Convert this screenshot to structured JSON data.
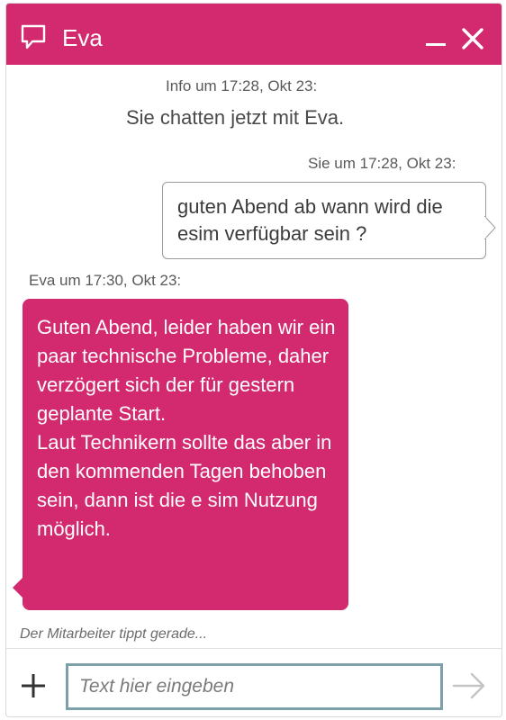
{
  "header": {
    "title": "Eva",
    "icons": {
      "chat": "chat-bubble-icon",
      "minimize": "minimize-icon",
      "close": "close-icon"
    },
    "background": "#d2296f"
  },
  "conversation": {
    "info_meta": "Info um 17:28, Okt 23:",
    "info_text": "Sie chatten jetzt mit Eva.",
    "user_meta": "Sie um 17:28, Okt 23:",
    "user_message": "guten Abend ab wann wird die esim verfügbar sein ?",
    "agent_meta": "Eva um 17:30, Okt 23:",
    "agent_message": "Guten Abend, leider haben wir ein paar technische Probleme, daher verzögert sich der für gestern geplante Start.\nLaut Technikern sollte das aber in den kommenden Tagen behoben sein, dann ist die e sim Nutzung möglich.",
    "typing_indicator": "Der Mitarbeiter tippt gerade..."
  },
  "composer": {
    "placeholder": "Text hier eingeben",
    "value": "",
    "icons": {
      "add": "plus-icon",
      "send": "send-arrow-icon"
    }
  },
  "colors": {
    "accent": "#d2296f",
    "input_border": "#7ea0a8",
    "meta_text": "#595959"
  }
}
